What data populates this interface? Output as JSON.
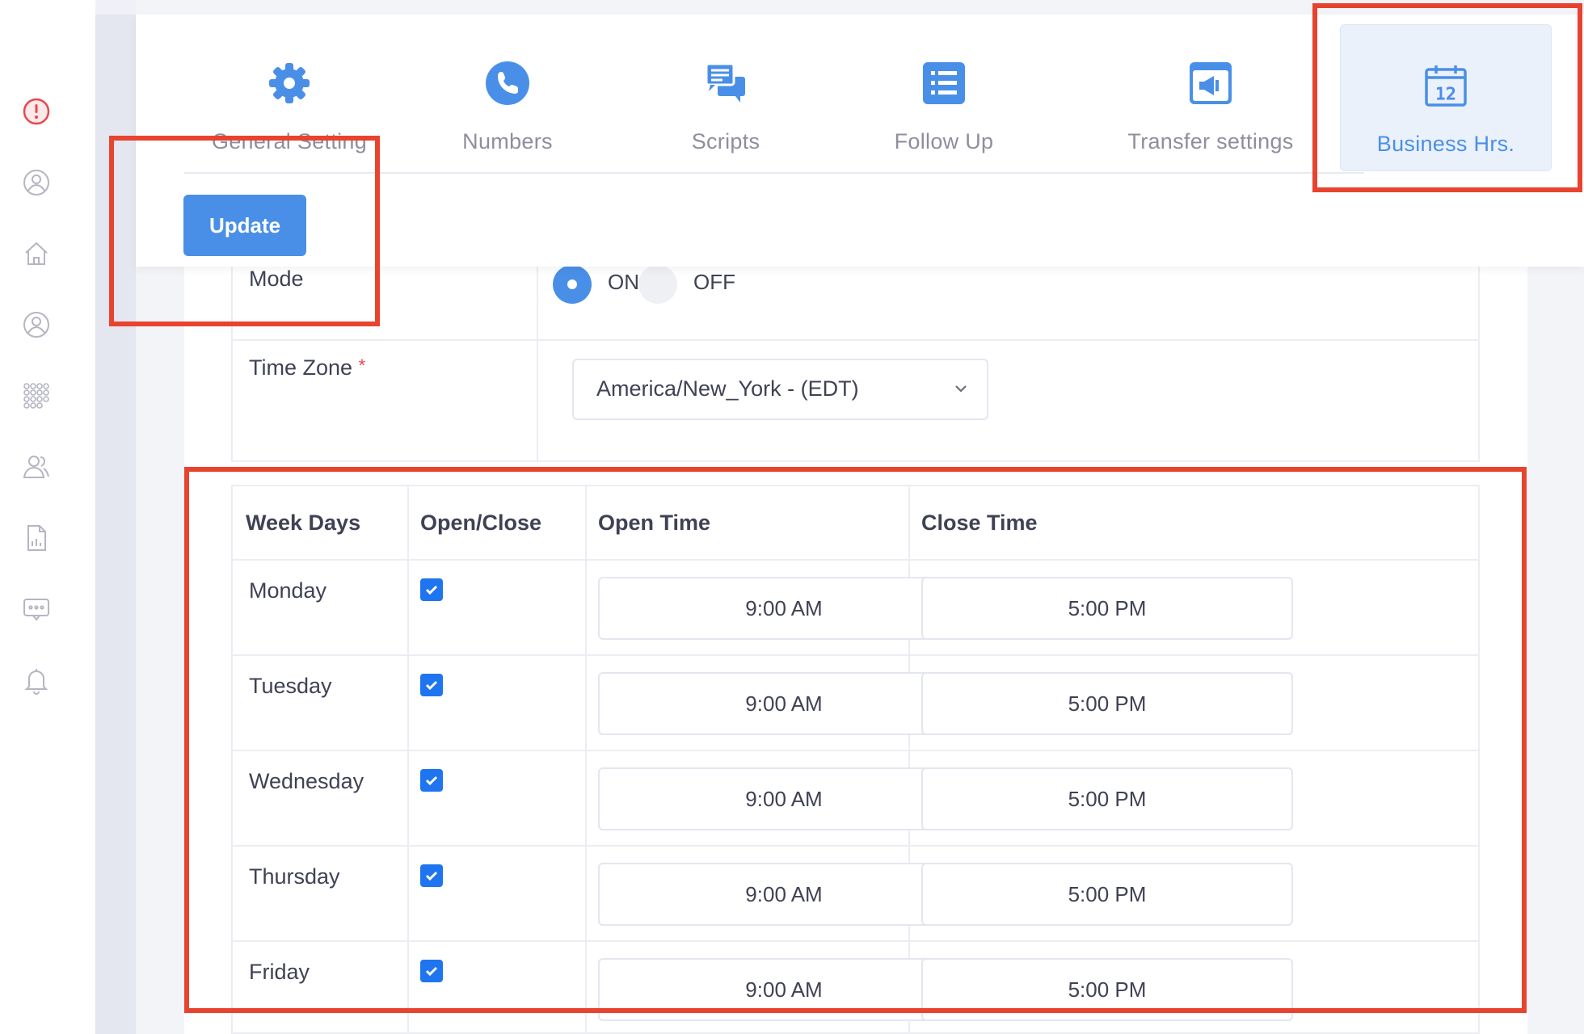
{
  "sidebar": {
    "items": [
      {
        "icon": "alert-circle-icon"
      },
      {
        "icon": "user-circle-icon"
      },
      {
        "icon": "home-icon"
      },
      {
        "icon": "user-circle-icon"
      },
      {
        "icon": "dots-grid-icon"
      },
      {
        "icon": "users-icon"
      },
      {
        "icon": "report-icon"
      },
      {
        "icon": "chat-icon"
      },
      {
        "icon": "bell-icon"
      }
    ]
  },
  "tabs": [
    {
      "label": "General Setting",
      "icon": "gear-icon",
      "active": false
    },
    {
      "label": "Numbers",
      "icon": "phone-icon",
      "active": false
    },
    {
      "label": "Scripts",
      "icon": "chat-bubbles-icon",
      "active": false
    },
    {
      "label": "Follow Up",
      "icon": "list-icon",
      "active": false
    },
    {
      "label": "Transfer settings",
      "icon": "megaphone-icon",
      "active": false
    },
    {
      "label": "Business Hrs.",
      "icon": "calendar-icon",
      "active": true
    }
  ],
  "toolbar": {
    "update_label": "Update"
  },
  "form": {
    "mode": {
      "label": "Mode",
      "on_label": "ON",
      "off_label": "OFF",
      "value": "ON"
    },
    "timezone": {
      "label": "Time Zone",
      "required_mark": "*",
      "value": "America/New_York - (EDT)"
    }
  },
  "schedule": {
    "headers": {
      "day": "Week Days",
      "open_close": "Open/Close",
      "open_time": "Open Time",
      "close_time": "Close Time"
    },
    "rows": [
      {
        "day": "Monday",
        "open": true,
        "open_time": "9:00 AM",
        "close_time": "5:00 PM"
      },
      {
        "day": "Tuesday",
        "open": true,
        "open_time": "9:00 AM",
        "close_time": "5:00 PM"
      },
      {
        "day": "Wednesday",
        "open": true,
        "open_time": "9:00 AM",
        "close_time": "5:00 PM"
      },
      {
        "day": "Thursday",
        "open": true,
        "open_time": "9:00 AM",
        "close_time": "5:00 PM"
      },
      {
        "day": "Friday",
        "open": true,
        "open_time": "9:00 AM",
        "close_time": "5:00 PM"
      }
    ]
  },
  "colors": {
    "accent": "#4a8fe7",
    "annotation": "#e8432e",
    "checkbox": "#1f74f0"
  }
}
